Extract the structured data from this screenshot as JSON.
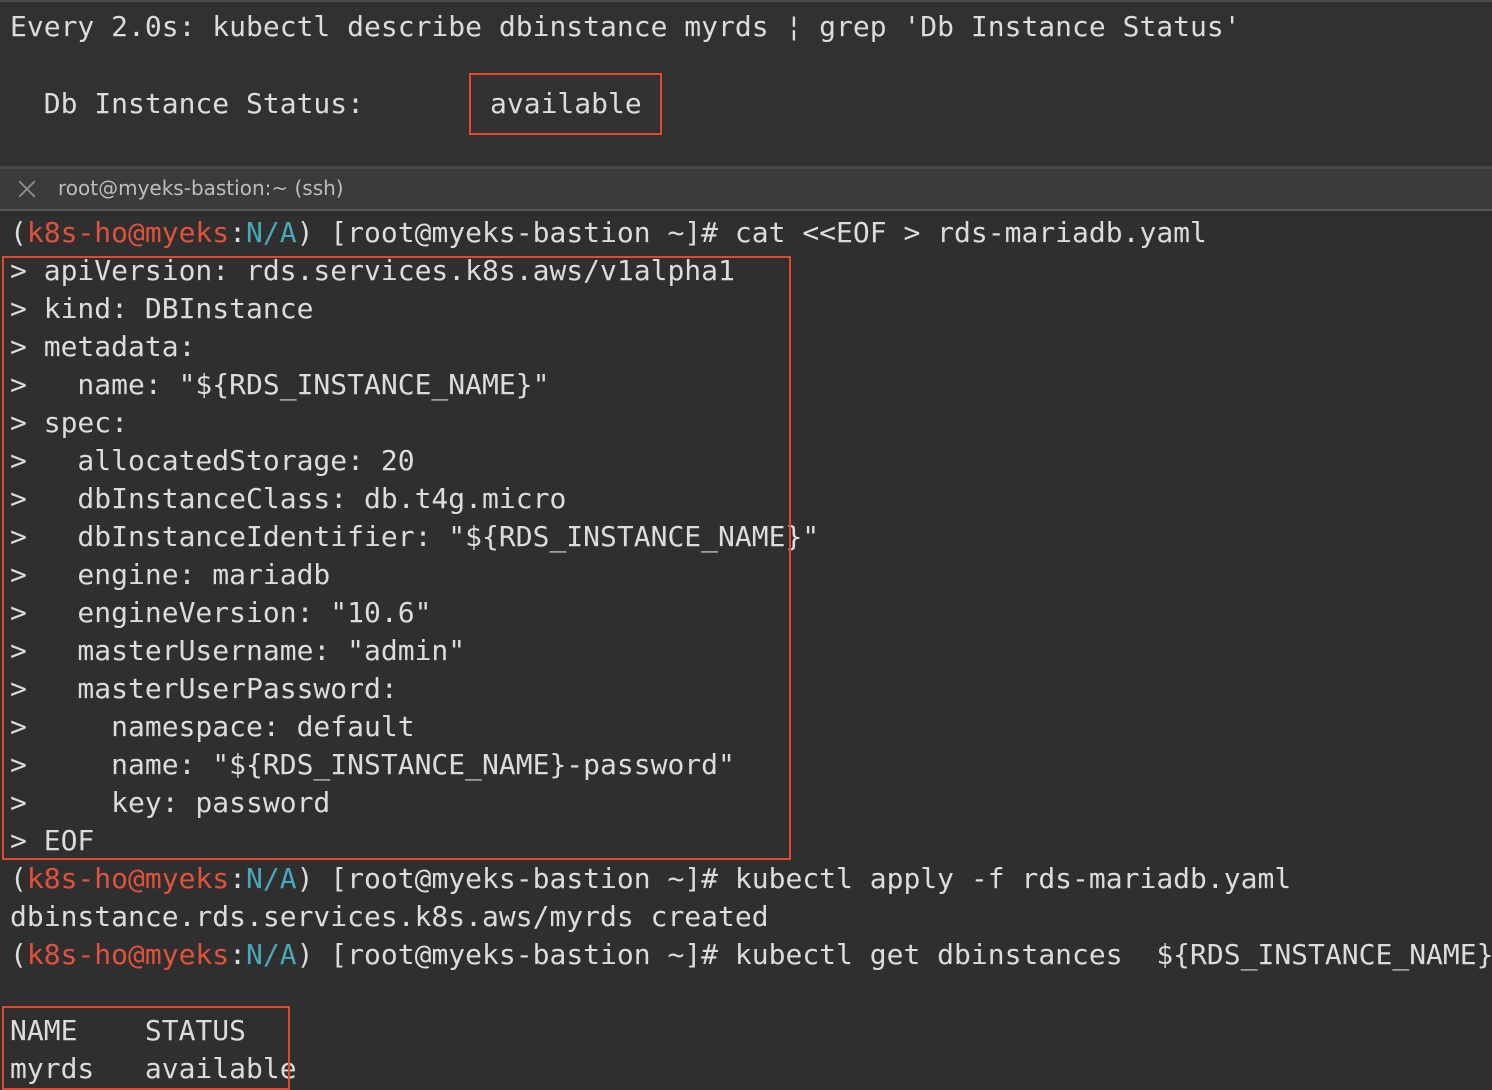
{
  "watch": {
    "header": "Every 2.0s: kubectl describe dbinstance myrds ¦ grep 'Db Instance Status'",
    "status_label": "  Db Instance Status:       ",
    "status_value": "available"
  },
  "tab": {
    "title": "root@myeks-bastion:~ (ssh)",
    "close_icon": "close-icon"
  },
  "prompt": {
    "open": "(",
    "context": "k8s-ho@myeks",
    "sep": ":",
    "namespace": "N/A",
    "close": ") [root@myeks-bastion ~]# "
  },
  "commands": {
    "cat": "cat <<EOF > rds-mariadb.yaml",
    "apply": "kubectl apply -f rds-mariadb.yaml",
    "get": "kubectl get dbinstances  ${RDS_INSTANCE_NAME}"
  },
  "heredoc": [
    "> apiVersion: rds.services.k8s.aws/v1alpha1",
    "> kind: DBInstance",
    "> metadata:",
    ">   name: \"${RDS_INSTANCE_NAME}\"",
    "> spec:",
    ">   allocatedStorage: 20",
    ">   dbInstanceClass: db.t4g.micro",
    ">   dbInstanceIdentifier: \"${RDS_INSTANCE_NAME}\"",
    ">   engine: mariadb",
    ">   engineVersion: \"10.6\"",
    ">   masterUsername: \"admin\"",
    ">   masterUserPassword:",
    ">     namespace: default",
    ">     name: \"${RDS_INSTANCE_NAME}-password\"",
    ">     key: password",
    "> EOF"
  ],
  "apply_output": "dbinstance.rds.services.k8s.aws/myrds created",
  "table": {
    "header": "NAME    STATUS",
    "row": "myrds   available"
  },
  "colors": {
    "highlight_box": "#e2472f",
    "prompt_context": "#e0523d",
    "prompt_namespace": "#48a8b8"
  }
}
